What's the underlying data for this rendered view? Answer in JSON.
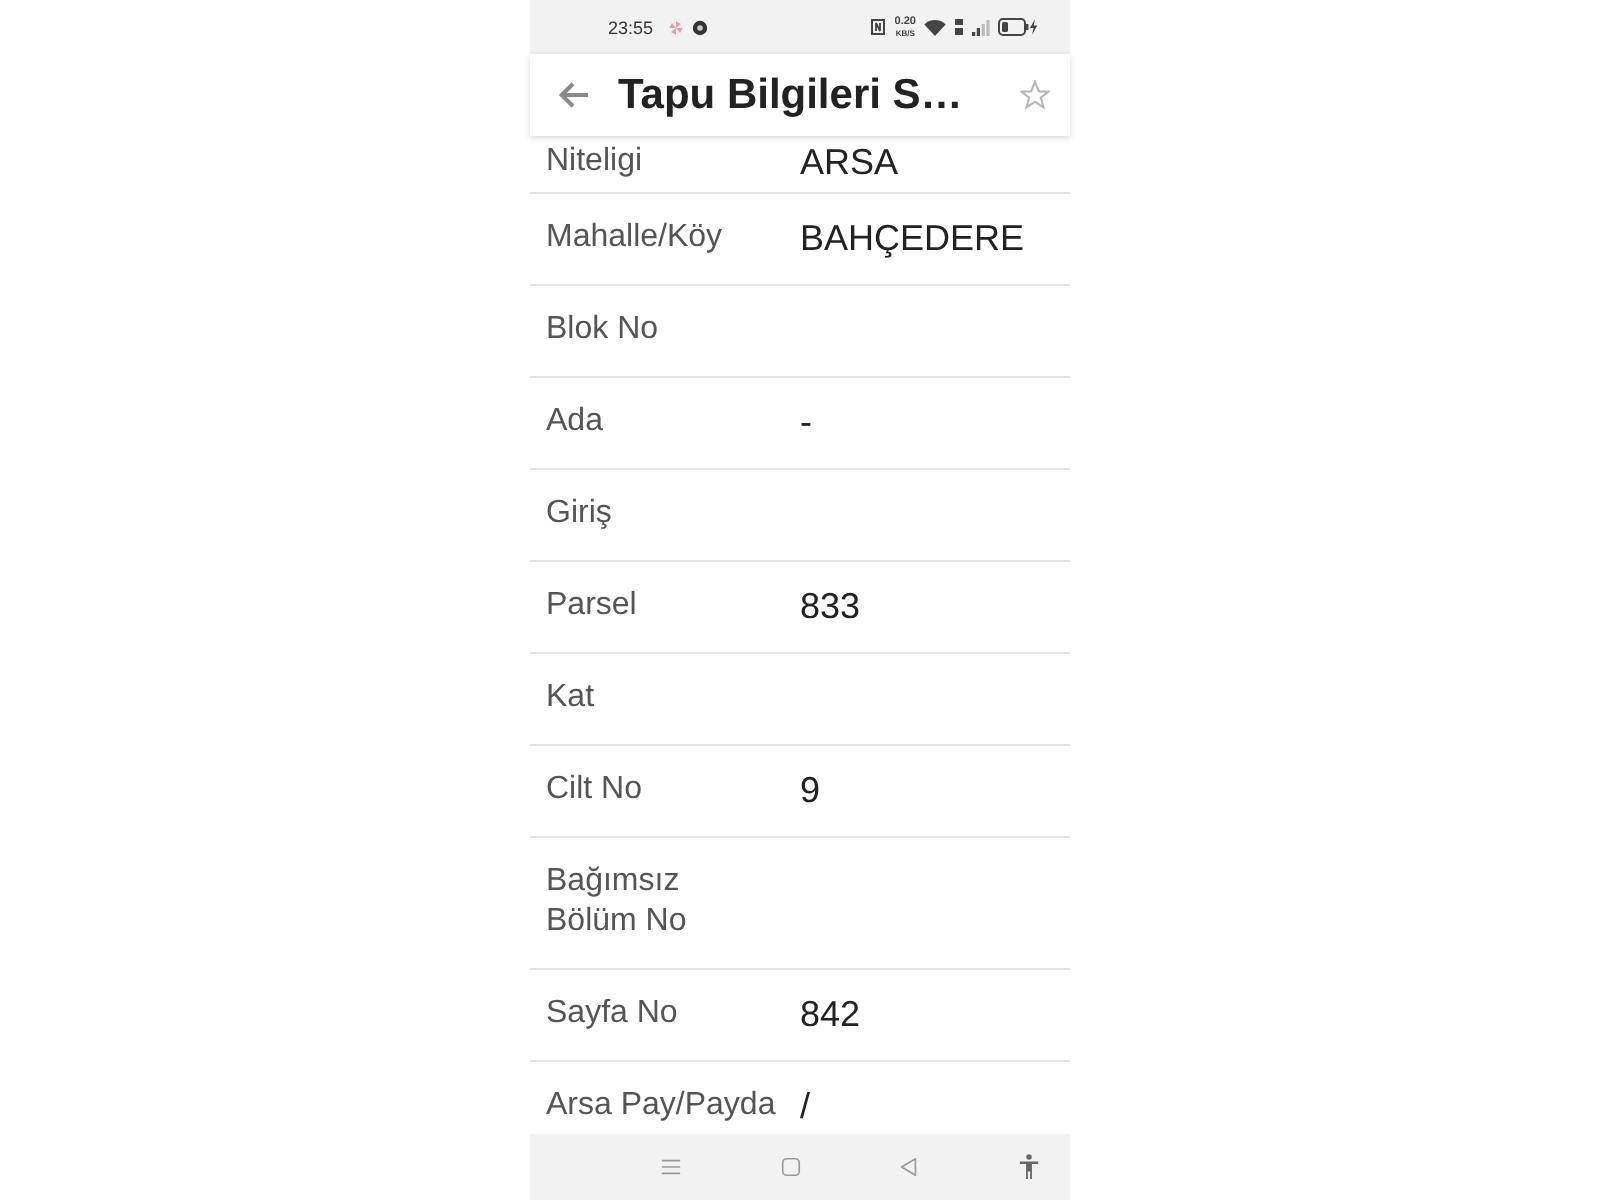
{
  "status_bar": {
    "time": "23:55",
    "net_speed": "0.20",
    "net_speed_unit": "KB/S"
  },
  "app_bar": {
    "title": "Tapu Bilgileri S…",
    "starred": false
  },
  "rows": [
    {
      "label": "Niteligi",
      "value": "ARSA"
    },
    {
      "label": "Mahalle/Köy",
      "value": "BAHÇEDERE"
    },
    {
      "label": "Blok No"
    },
    {
      "label": "Ada",
      "value": "-"
    },
    {
      "label": "Giriş"
    },
    {
      "label": "Parsel",
      "value": "833"
    },
    {
      "label": "Kat"
    },
    {
      "label": "Cilt No",
      "value": "9"
    },
    {
      "label": "Bağımsız\nBölüm No"
    },
    {
      "label": "Sayfa No",
      "value": "842"
    },
    {
      "label": "Arsa Pay/Payda",
      "value": "/"
    }
  ]
}
